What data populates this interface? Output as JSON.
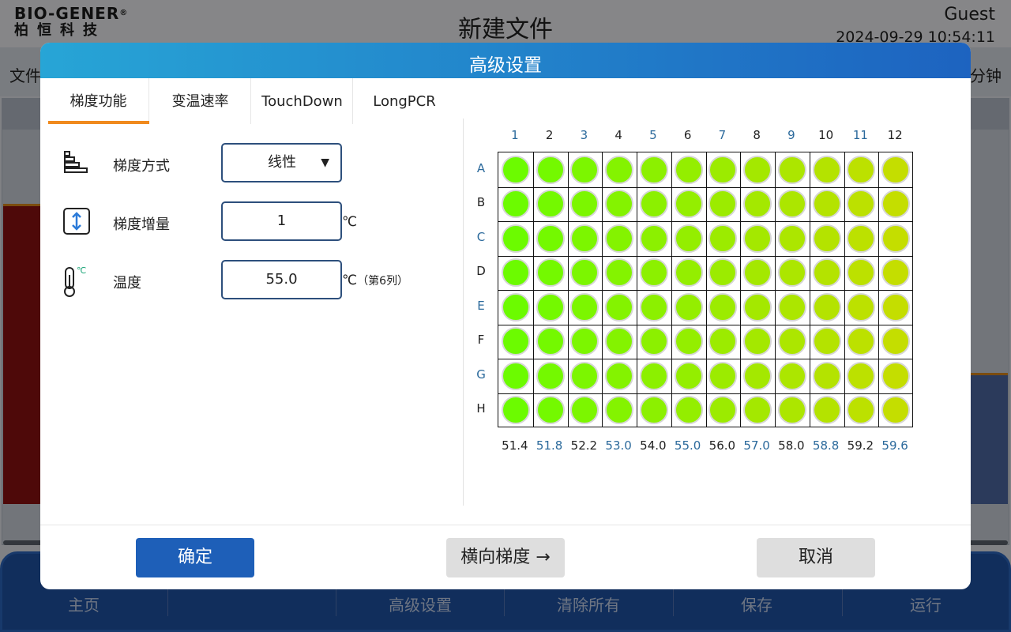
{
  "app": {
    "logo_en": "BIO-GENER",
    "logo_reg": "®",
    "logo_cn": "柏恒科技",
    "title": "新建文件",
    "user": "Guest",
    "datetime": "2024-09-29 10:54:11",
    "menu_left": "文件",
    "menu_right": "分钟"
  },
  "bottom_nav": [
    {
      "label": "主页"
    },
    {
      "label": "高级设置"
    },
    {
      "label": "清除所有"
    },
    {
      "label": "保存"
    },
    {
      "label": "运行"
    }
  ],
  "dialog": {
    "title": "高级设置",
    "tabs": [
      "梯度功能",
      "变温速率",
      "TouchDown",
      "LongPCR"
    ],
    "active_tab": "梯度功能",
    "gradient_mode": {
      "label": "梯度方式",
      "value": "线性",
      "arrow": "▼"
    },
    "gradient_step": {
      "label": "梯度增量",
      "value": "1",
      "unit": "℃"
    },
    "temperature": {
      "label": "温度",
      "value": "55.0",
      "unit": "℃",
      "note": "（第6列）",
      "icon_unit": "℃"
    },
    "plate": {
      "columns": [
        "1",
        "2",
        "3",
        "4",
        "5",
        "6",
        "7",
        "8",
        "9",
        "10",
        "11",
        "12"
      ],
      "rows": [
        "A",
        "B",
        "C",
        "D",
        "E",
        "F",
        "G",
        "H"
      ],
      "column_temps": [
        "51.4",
        "51.8",
        "52.2",
        "53.0",
        "54.0",
        "55.0",
        "56.0",
        "57.0",
        "58.0",
        "58.8",
        "59.2",
        "59.6"
      ],
      "well_colors": [
        "#6cfb00",
        "#74f900",
        "#7cf600",
        "#84f300",
        "#8cf000",
        "#94ee00",
        "#9ceb00",
        "#a4e800",
        "#ace600",
        "#b4e300",
        "#bce100",
        "#c4de00"
      ]
    },
    "buttons": {
      "ok": "确定",
      "gradient_dir": "横向梯度 →",
      "cancel": "取消"
    },
    "colors": {
      "header_start": "#27a5d6",
      "header_end": "#1d63c0",
      "tab_underline": "#f08a1d",
      "ok_button": "#1e5fb8",
      "label_blue": "#2c6a9c"
    }
  }
}
